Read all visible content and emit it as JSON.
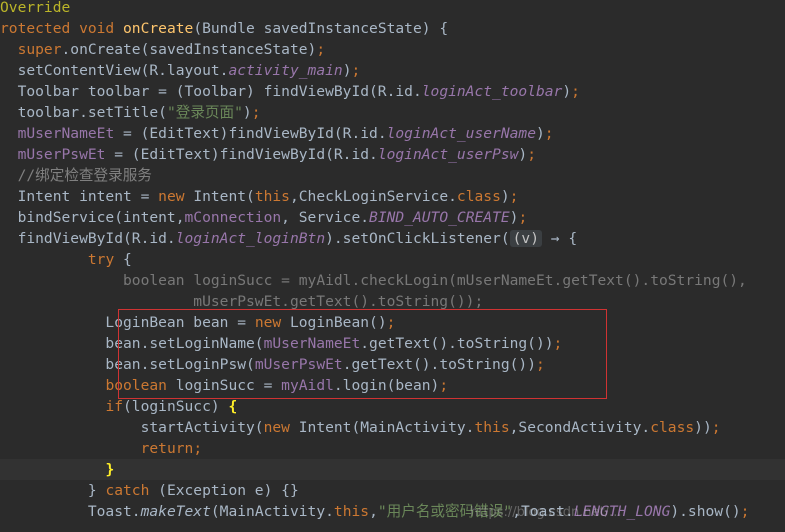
{
  "code": {
    "lines": [
      [
        {
          "t": "Override",
          "c": "ann"
        }
      ],
      [
        {
          "t": "rotected void ",
          "c": "kw"
        },
        {
          "t": "onCreate",
          "c": "fn"
        },
        {
          "t": "(Bundle savedInstanceState) {",
          "c": "pl"
        }
      ],
      [
        {
          "t": "  ",
          "c": "pl"
        },
        {
          "t": "super",
          "c": "kw"
        },
        {
          "t": ".onCreate(savedInstanceState)",
          "c": "pl"
        },
        {
          "t": ";",
          "c": "kw"
        }
      ],
      [
        {
          "t": "  setContentView(R.layout.",
          "c": "pl"
        },
        {
          "t": "activity_main",
          "c": "fld it"
        },
        {
          "t": ")",
          "c": "pl"
        },
        {
          "t": ";",
          "c": "kw"
        }
      ],
      [
        {
          "t": "  Toolbar toolbar = (Toolbar) findViewById(R.id.",
          "c": "pl"
        },
        {
          "t": "loginAct_toolbar",
          "c": "fld it"
        },
        {
          "t": ")",
          "c": "pl"
        },
        {
          "t": ";",
          "c": "kw"
        }
      ],
      [
        {
          "t": "  toolbar.setTitle(",
          "c": "pl"
        },
        {
          "t": "\"登录页面\"",
          "c": "str"
        },
        {
          "t": ")",
          "c": "pl"
        },
        {
          "t": ";",
          "c": "kw"
        }
      ],
      [
        {
          "t": "  ",
          "c": "pl"
        },
        {
          "t": "mUserNameEt",
          "c": "fld"
        },
        {
          "t": " = (EditText)findViewById(R.id.",
          "c": "pl"
        },
        {
          "t": "loginAct_userName",
          "c": "fld it"
        },
        {
          "t": ")",
          "c": "pl"
        },
        {
          "t": ";",
          "c": "kw"
        }
      ],
      [
        {
          "t": "  ",
          "c": "pl"
        },
        {
          "t": "mUserPswEt",
          "c": "fld"
        },
        {
          "t": " = (EditText)findViewById(R.id.",
          "c": "pl"
        },
        {
          "t": "loginAct_userPsw",
          "c": "fld it"
        },
        {
          "t": ")",
          "c": "pl"
        },
        {
          "t": ";",
          "c": "kw"
        }
      ],
      [
        {
          "t": "  //绑定检查登录服务",
          "c": "cm"
        }
      ],
      [
        {
          "t": "  Intent intent = ",
          "c": "pl"
        },
        {
          "t": "new ",
          "c": "kw"
        },
        {
          "t": "Intent(",
          "c": "pl"
        },
        {
          "t": "this",
          "c": "kw"
        },
        {
          "t": ",CheckLoginService.",
          "c": "pl"
        },
        {
          "t": "class",
          "c": "kw"
        },
        {
          "t": ")",
          "c": "pl"
        },
        {
          "t": ";",
          "c": "kw"
        }
      ],
      [
        {
          "t": "  bindService(intent,",
          "c": "pl"
        },
        {
          "t": "mConnection",
          "c": "fld"
        },
        {
          "t": ", Service.",
          "c": "pl"
        },
        {
          "t": "BIND_AUTO_CREATE",
          "c": "fld it"
        },
        {
          "t": ")",
          "c": "pl"
        },
        {
          "t": ";",
          "c": "kw"
        }
      ],
      [
        {
          "t": "  findViewById(R.id.",
          "c": "pl"
        },
        {
          "t": "loginAct_loginBtn",
          "c": "fld it"
        },
        {
          "t": ").setOnClickListener(",
          "c": "pl"
        },
        {
          "t": "(v)",
          "c": "hint"
        },
        {
          "t": " → {",
          "c": "hintarrow"
        }
      ],
      [
        {
          "t": "          ",
          "c": "pl"
        },
        {
          "t": "try ",
          "c": "kw"
        },
        {
          "t": "{",
          "c": "pl"
        }
      ],
      [
        {
          "t": "              ",
          "c": "pl"
        },
        {
          "t": "boolean ",
          "c": "kw dim"
        },
        {
          "t": "loginSucc = myAidl.checkLogin(mUserNameEt.getText().toString(),",
          "c": "dim"
        }
      ],
      [
        {
          "t": "                      mUserPswEt.getText().toString());",
          "c": "dim"
        }
      ],
      [
        {
          "t": "            LoginBean bean = ",
          "c": "pl"
        },
        {
          "t": "new ",
          "c": "kw"
        },
        {
          "t": "LoginBean()",
          "c": "pl"
        },
        {
          "t": ";",
          "c": "kw"
        }
      ],
      [
        {
          "t": "            bean.setLoginName(",
          "c": "pl"
        },
        {
          "t": "mUserNameEt",
          "c": "fld"
        },
        {
          "t": ".getText().toString())",
          "c": "pl"
        },
        {
          "t": ";",
          "c": "kw"
        }
      ],
      [
        {
          "t": "            bean.setLoginPsw(",
          "c": "pl"
        },
        {
          "t": "mUserPswEt",
          "c": "fld"
        },
        {
          "t": ".getText().toString())",
          "c": "pl"
        },
        {
          "t": ";",
          "c": "kw"
        }
      ],
      [
        {
          "t": "            ",
          "c": "pl"
        },
        {
          "t": "boolean ",
          "c": "kw"
        },
        {
          "t": "loginSucc = ",
          "c": "pl"
        },
        {
          "t": "myAidl",
          "c": "fld"
        },
        {
          "t": ".login(bean)",
          "c": "pl"
        },
        {
          "t": ";",
          "c": "kw"
        }
      ],
      [
        {
          "t": "            ",
          "c": "pl"
        },
        {
          "t": "if",
          "c": "kw"
        },
        {
          "t": "(loginSucc) ",
          "c": "pl"
        },
        {
          "t": "{",
          "c": "brk"
        }
      ],
      [
        {
          "t": "                startActivity(",
          "c": "pl"
        },
        {
          "t": "new ",
          "c": "kw"
        },
        {
          "t": "Intent(MainActivity.",
          "c": "pl"
        },
        {
          "t": "this",
          "c": "kw"
        },
        {
          "t": ",SecondActivity.",
          "c": "pl"
        },
        {
          "t": "class",
          "c": "kw"
        },
        {
          "t": "))",
          "c": "pl"
        },
        {
          "t": ";",
          "c": "kw"
        }
      ],
      [
        {
          "t": "                ",
          "c": "pl"
        },
        {
          "t": "return",
          "c": "kw"
        },
        {
          "t": ";",
          "c": "kw"
        }
      ],
      [
        {
          "t": "            ",
          "c": "pl"
        },
        {
          "t": "}",
          "c": "brk"
        }
      ],
      [
        {
          "t": "          } ",
          "c": "pl"
        },
        {
          "t": "catch ",
          "c": "kw"
        },
        {
          "t": "(Exception e) {}",
          "c": "pl"
        }
      ],
      [
        {
          "t": "          Toast.",
          "c": "pl"
        },
        {
          "t": "makeText",
          "c": "it"
        },
        {
          "t": "(MainActivity.",
          "c": "pl"
        },
        {
          "t": "this",
          "c": "kw"
        },
        {
          "t": ",",
          "c": "pl"
        },
        {
          "t": "\"用户名或密码错误\"",
          "c": "str"
        },
        {
          "t": ",Toast.",
          "c": "pl"
        },
        {
          "t": "LENGTH_LONG",
          "c": "fld it"
        },
        {
          "t": ").show()",
          "c": "pl"
        },
        {
          "t": ";",
          "c": "kw"
        }
      ]
    ]
  },
  "watermark": "https://blog.csdn.net/..."
}
